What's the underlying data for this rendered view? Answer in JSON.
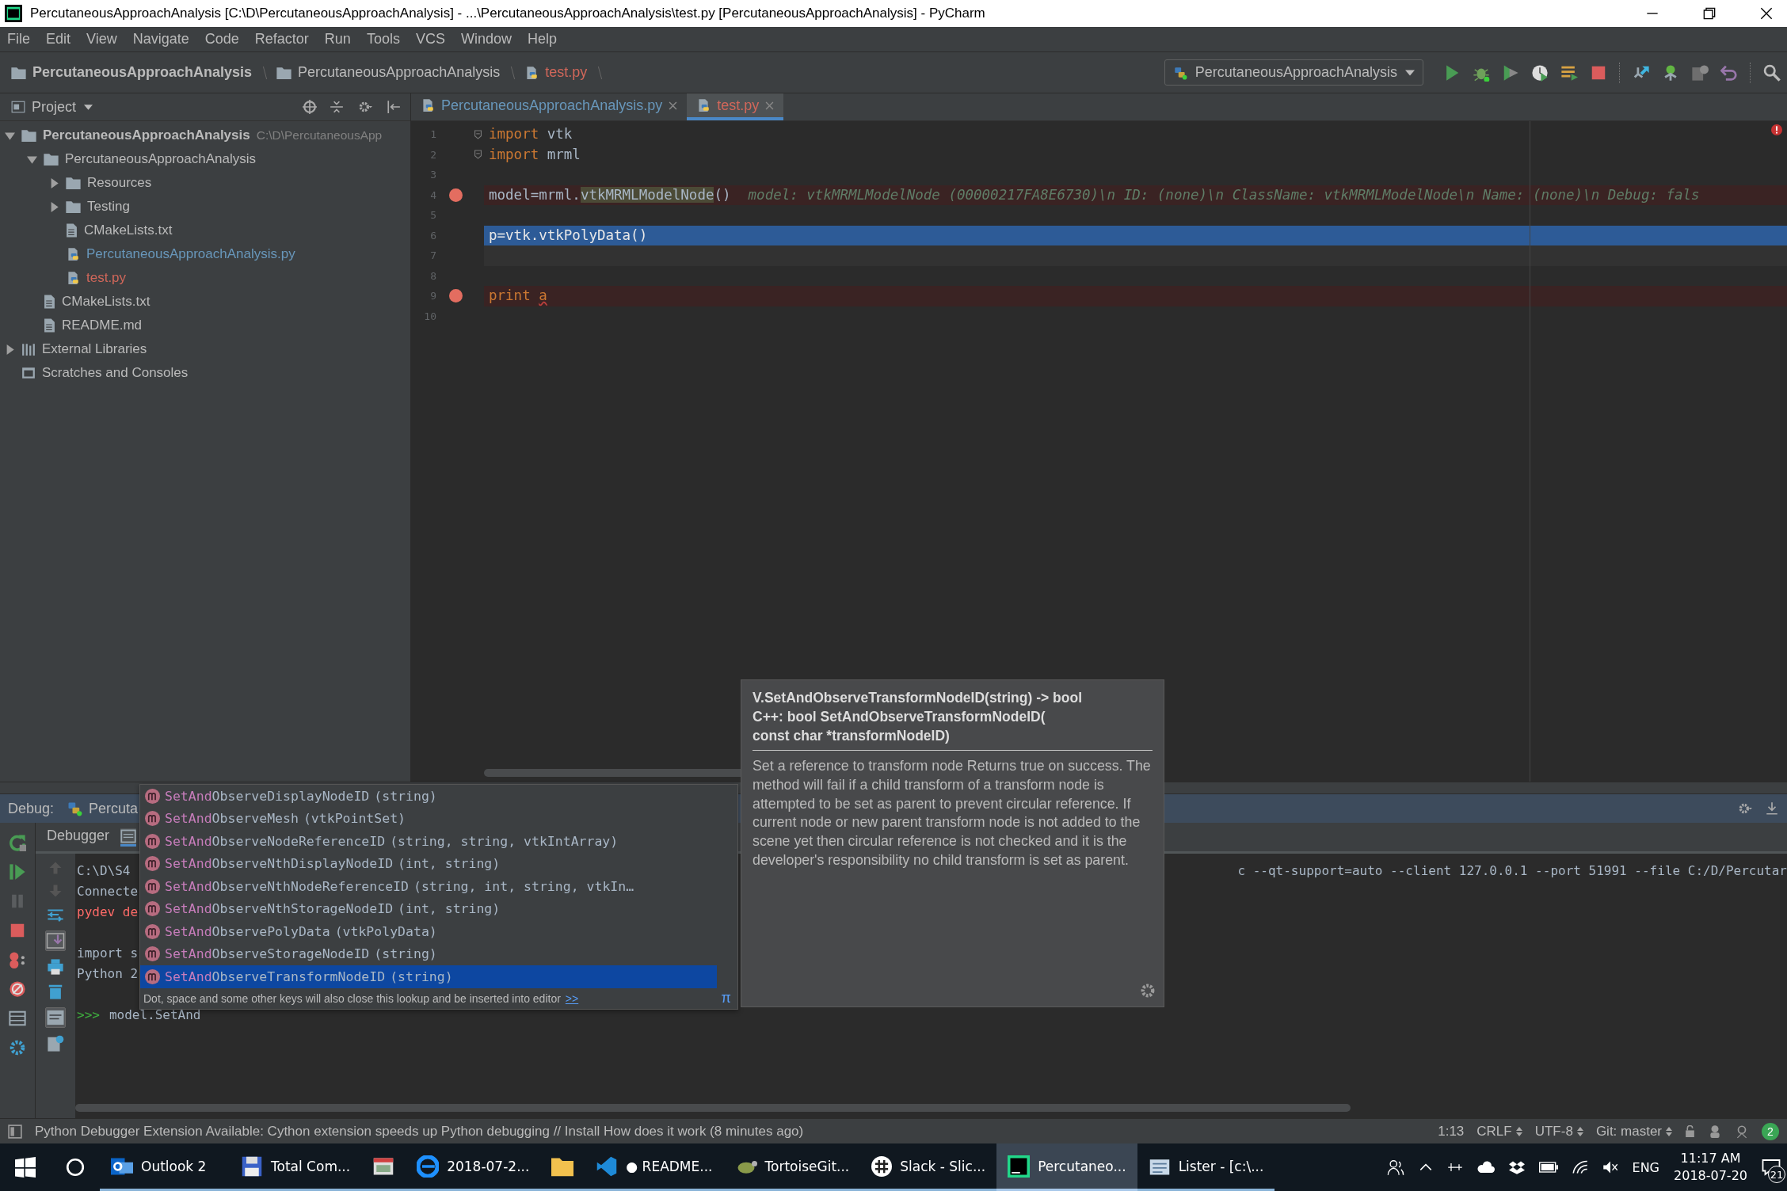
{
  "window": {
    "title": "PercutaneousApproachAnalysis [C:\\D\\PercutaneousApproachAnalysis] - ...\\PercutaneousApproachAnalysis\\test.py [PercutaneousApproachAnalysis] - PyCharm"
  },
  "menu": [
    "File",
    "Edit",
    "View",
    "Navigate",
    "Code",
    "Refactor",
    "Run",
    "Tools",
    "VCS",
    "Window",
    "Help"
  ],
  "breadcrumbs": [
    {
      "label": "PercutaneousApproachAnalysis",
      "kind": "project"
    },
    {
      "label": "PercutaneousApproachAnalysis",
      "kind": "folder"
    },
    {
      "label": "test.py",
      "kind": "file",
      "color": "#d1675a"
    }
  ],
  "run_config": {
    "label": "PercutaneousApproachAnalysis"
  },
  "project": {
    "title": "Project",
    "tree": [
      {
        "label": "PercutaneousApproachAnalysis",
        "kind": "project",
        "path": "C:\\D\\PercutaneousApp",
        "expanded": true,
        "children": [
          {
            "label": "PercutaneousApproachAnalysis",
            "kind": "folder",
            "expanded": true,
            "children": [
              {
                "label": "Resources",
                "kind": "folder",
                "expanded": false
              },
              {
                "label": "Testing",
                "kind": "folder",
                "expanded": false
              },
              {
                "label": "CMakeLists.txt",
                "kind": "file"
              },
              {
                "label": "PercutaneousApproachAnalysis.py",
                "kind": "python",
                "color": "#6897bb"
              },
              {
                "label": "test.py",
                "kind": "python",
                "color": "#d1675a"
              }
            ]
          },
          {
            "label": "CMakeLists.txt",
            "kind": "file"
          },
          {
            "label": "README.md",
            "kind": "file"
          }
        ]
      },
      {
        "label": "External Libraries",
        "kind": "libraries",
        "expanded": false
      },
      {
        "label": "Scratches and Consoles",
        "kind": "scratches"
      }
    ]
  },
  "editor": {
    "tabs": [
      {
        "label": "PercutaneousApproachAnalysis.py",
        "color": "#6897bb",
        "selected": false
      },
      {
        "label": "test.py",
        "color": "#d1675a",
        "selected": true
      }
    ],
    "lines": [
      {
        "number": "1",
        "breakpoint": false,
        "execution": false,
        "caret": false,
        "fold": true,
        "tokens": [
          {
            "text": "import",
            "kind": "keyword"
          },
          {
            "text": " vtk",
            "kind": "plain"
          }
        ]
      },
      {
        "number": "2",
        "breakpoint": false,
        "execution": false,
        "caret": false,
        "fold": true,
        "tokens": [
          {
            "text": "import",
            "kind": "keyword"
          },
          {
            "text": " mrml",
            "kind": "plain"
          }
        ]
      },
      {
        "number": "3",
        "breakpoint": false,
        "execution": false,
        "caret": false,
        "fold": false
      },
      {
        "number": "4",
        "breakpoint": true,
        "execution": false,
        "caret": false,
        "fold": false,
        "tokens": [
          {
            "text": "model=mrml.",
            "kind": "plain"
          },
          {
            "text": "vtkMRMLModelNode",
            "kind": "ref"
          },
          {
            "text": "()",
            "kind": "plain"
          },
          {
            "text": "model: vtkMRMLModelNode (00000217FA8E6730)\\n  ID: (none)\\n  ClassName: vtkMRMLModelNode\\n  Name: (none)\\n  Debug: fals",
            "kind": "value"
          }
        ]
      },
      {
        "number": "5",
        "breakpoint": false,
        "execution": false,
        "caret": false,
        "fold": false
      },
      {
        "number": "6",
        "breakpoint": false,
        "execution": true,
        "caret": false,
        "fold": false,
        "tokens": [
          {
            "text": "p=vtk.vtkPolyData()",
            "kind": "plain"
          }
        ]
      },
      {
        "number": "7",
        "breakpoint": false,
        "execution": false,
        "caret": true,
        "fold": false
      },
      {
        "number": "8",
        "breakpoint": false,
        "execution": false,
        "caret": false,
        "fold": false
      },
      {
        "number": "9",
        "breakpoint": true,
        "execution": false,
        "caret": false,
        "fold": false,
        "tokens": [
          {
            "text": "print ",
            "kind": "keyword"
          },
          {
            "text": "a",
            "kind": "unresolved"
          }
        ]
      },
      {
        "number": "10",
        "breakpoint": false,
        "execution": false,
        "caret": false,
        "fold": false
      }
    ]
  },
  "debug": {
    "label": "Debug:",
    "session": "Percuta",
    "tabs": [
      {
        "label": "Debugger",
        "selected": false
      },
      {
        "selected": true
      }
    ],
    "console": [
      {
        "kind": "plain",
        "text": "C:\\D\\S4",
        "tail": "c --qt-support=auto --client 127.0.0.1 --port 51991 --file C:/D/Percutar"
      },
      {
        "kind": "plain",
        "text": "Connecte"
      },
      {
        "kind": "error",
        "text": "pydev de"
      },
      {
        "kind": "blank"
      },
      {
        "kind": "plain",
        "text": "import s"
      },
      {
        "kind": "plain",
        "text": "Python 2"
      },
      {
        "kind": "blank"
      },
      {
        "kind": "prompt",
        "prompt": ">>>",
        "text": "model.SetAnd"
      }
    ]
  },
  "completion": {
    "items": [
      {
        "match": "SetAnd",
        "name": "ObserveDisplayNodeID",
        "args": "(string)",
        "selected": false
      },
      {
        "match": "SetAnd",
        "name": "ObserveMesh",
        "args": "(vtkPointSet)",
        "selected": false
      },
      {
        "match": "SetAnd",
        "name": "ObserveNodeReferenceID",
        "args": "(string, string, vtkIntArray)",
        "selected": false
      },
      {
        "match": "SetAnd",
        "name": "ObserveNthDisplayNodeID",
        "args": "(int, string)",
        "selected": false
      },
      {
        "match": "SetAnd",
        "name": "ObserveNthNodeReferenceID",
        "args": "(string, int, string,    vtkIn…",
        "selected": false
      },
      {
        "match": "SetAnd",
        "name": "ObserveNthStorageNodeID",
        "args": "(int, string)",
        "selected": false
      },
      {
        "match": "SetAnd",
        "name": "ObservePolyData",
        "args": "(vtkPolyData)",
        "selected": false
      },
      {
        "match": "SetAnd",
        "name": "ObserveStorageNodeID",
        "args": "(string)",
        "selected": false
      },
      {
        "match": "SetAnd",
        "name": "ObserveTransformNodeID",
        "args": "(string)",
        "selected": true
      }
    ],
    "hint": "Dot, space and some other keys will also close this lookup and be inserted into editor",
    "hint_link": ">>",
    "pi": "π"
  },
  "doc": {
    "title": [
      "V.SetAndObserveTransformNodeID(string) -> bool",
      "C++: bool SetAndObserveTransformNodeID(",
      "const char *transformNodeID)"
    ],
    "body": "Set a reference to transform node Returns true on success. The method will fail if a child transform of a transform node is attempted to be set as parent to prevent circular reference. If current node or new parent transform node is not added to the scene yet then circular reference is not checked and it is the developer's responsibility no child transform is set as parent."
  },
  "status_bar": {
    "message": "Python Debugger Extension Available: Cython extension speeds up Python debugging // Install How does it work (8 minutes ago)",
    "position": "1:13",
    "widgets": [
      "CRLF",
      "UTF-8",
      "Git: master"
    ],
    "notifications": "2"
  },
  "taskbar": {
    "apps": [
      {
        "label": "Outlook 2",
        "kind": "mail",
        "selected": false
      },
      {
        "label": "Total Com...",
        "kind": "disk",
        "selected": false
      },
      {
        "kind": "window",
        "selected": false
      },
      {
        "label": "2018-07-2...",
        "kind": "browser",
        "selected": false
      },
      {
        "kind": "folder",
        "selected": false
      },
      {
        "label": "● README...",
        "kind": "code",
        "selected": false
      },
      {
        "label": "TortoiseGit...",
        "kind": "turtle",
        "selected": false
      },
      {
        "label": "Slack - Slic...",
        "kind": "chat",
        "selected": false
      },
      {
        "label": "Percutaneo...",
        "kind": "ide",
        "selected": true
      },
      {
        "label": "Lister - [c:\\...",
        "kind": "viewer",
        "selected": false
      }
    ],
    "language": "ENG",
    "time": "11:17 AM",
    "date": "2018-07-20",
    "notifications": "21"
  }
}
